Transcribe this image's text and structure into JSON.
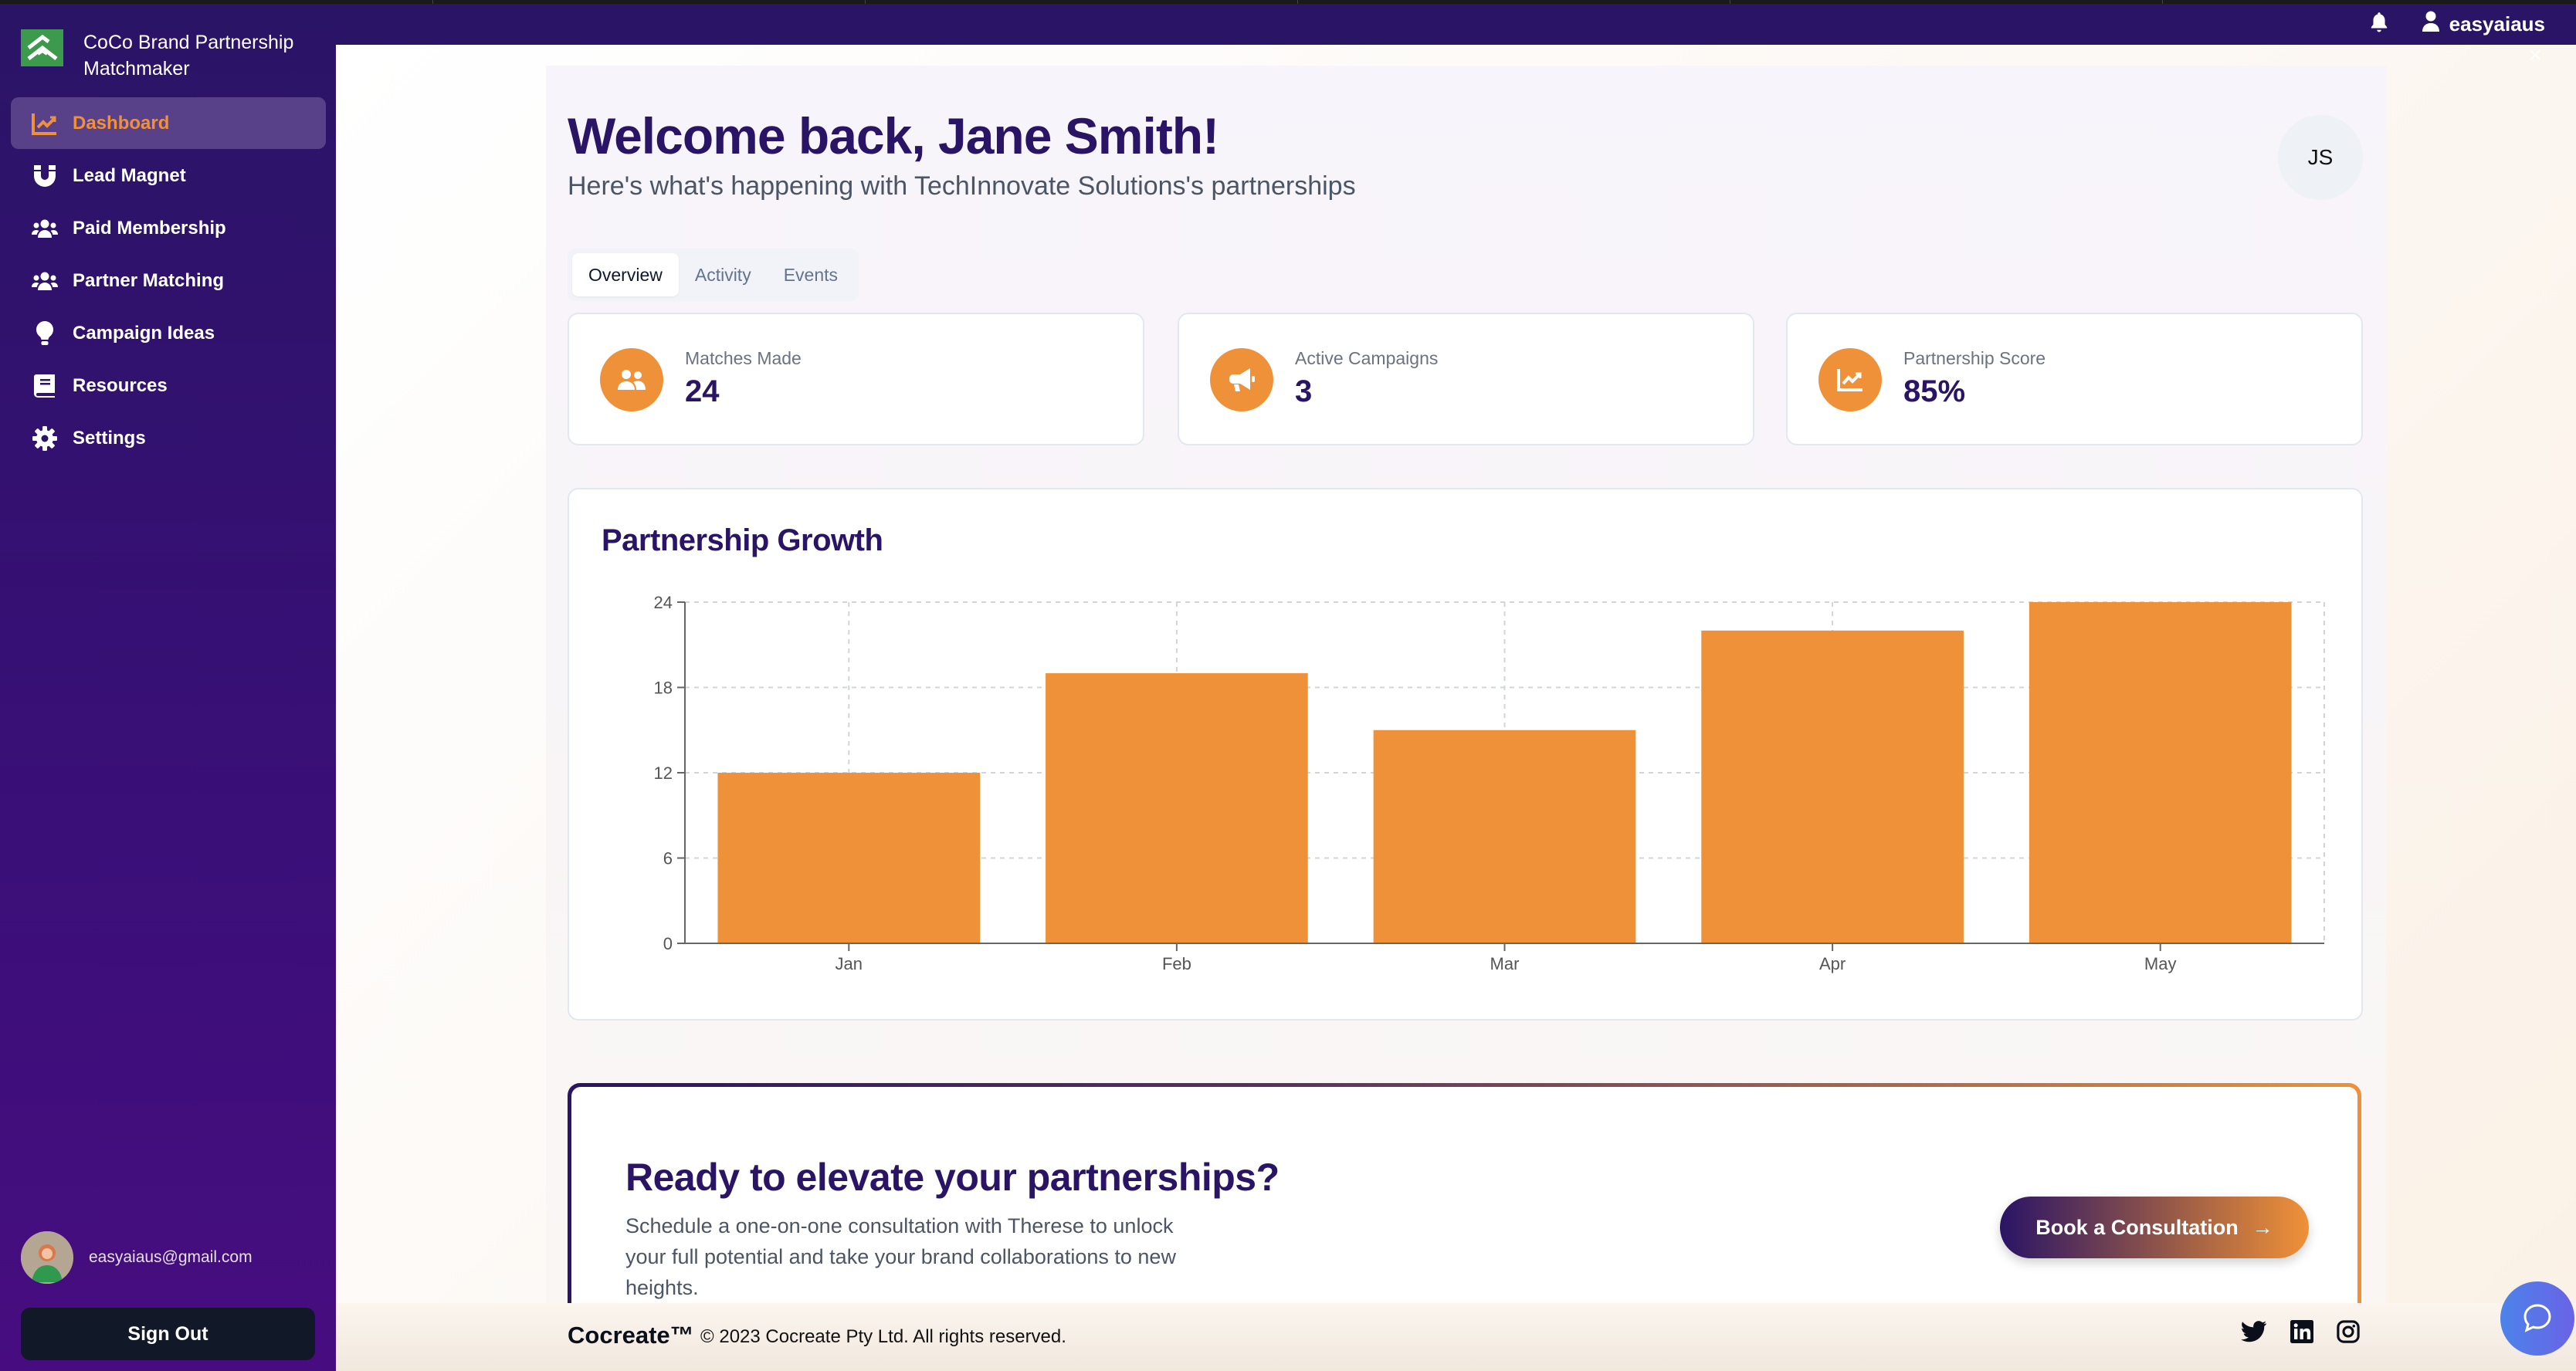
{
  "app": {
    "title": "CoCo Brand Partnership Matchmaker"
  },
  "topbar": {
    "username": "easyaiaus",
    "icons": [
      "bell-icon",
      "user-icon",
      "close-icon"
    ],
    "close_glyph": "×"
  },
  "sidebar": {
    "items": [
      {
        "label": "Dashboard",
        "icon": "chart-line-icon",
        "active": true
      },
      {
        "label": "Lead Magnet",
        "icon": "magnet-icon",
        "active": false
      },
      {
        "label": "Paid Membership",
        "icon": "users-icon",
        "active": false
      },
      {
        "label": "Partner Matching",
        "icon": "users-icon",
        "active": false
      },
      {
        "label": "Campaign Ideas",
        "icon": "lightbulb-icon",
        "active": false
      },
      {
        "label": "Resources",
        "icon": "book-icon",
        "active": false
      },
      {
        "label": "Settings",
        "icon": "gear-icon",
        "active": false
      }
    ],
    "user_email": "easyaiaus@gmail.com",
    "sign_out_label": "Sign Out"
  },
  "header": {
    "welcome": "Welcome back, Jane Smith!",
    "subtitle": "Here's what's happening with TechInnovate Solutions's partnerships",
    "avatar_initials": "JS"
  },
  "tabs": [
    {
      "label": "Overview",
      "active": true
    },
    {
      "label": "Activity",
      "active": false
    },
    {
      "label": "Events",
      "active": false
    }
  ],
  "stats": [
    {
      "label": "Matches Made",
      "value": "24",
      "icon": "users-icon"
    },
    {
      "label": "Active Campaigns",
      "value": "3",
      "icon": "megaphone-icon"
    },
    {
      "label": "Partnership Score",
      "value": "85%",
      "icon": "chart-line-icon"
    }
  ],
  "chart_data": {
    "type": "bar",
    "title": "Partnership Growth",
    "categories": [
      "Jan",
      "Feb",
      "Mar",
      "Apr",
      "May"
    ],
    "values": [
      12,
      19,
      15,
      22,
      24
    ],
    "xlabel": "",
    "ylabel": "",
    "ylim": [
      0,
      24
    ],
    "yticks": [
      0,
      6,
      12,
      18,
      24
    ],
    "grid": true,
    "legend": "none",
    "bar_color": "#ef9138"
  },
  "cta": {
    "title": "Ready to elevate your partnerships?",
    "text": "Schedule a one-on-one consultation with Therese to unlock your full potential and take your brand collaborations to new heights.",
    "button_label": "Book a Consultation",
    "button_arrow": "→"
  },
  "footer": {
    "brand": "Cocreate™",
    "copyright": "© 2023 Cocreate Pty Ltd. All rights reserved.",
    "social": [
      "twitter-icon",
      "linkedin-icon",
      "instagram-icon"
    ]
  },
  "colors": {
    "brand_purple": "#2a1466",
    "accent_orange": "#ef9138",
    "chat_blue": "#4c83ea"
  }
}
